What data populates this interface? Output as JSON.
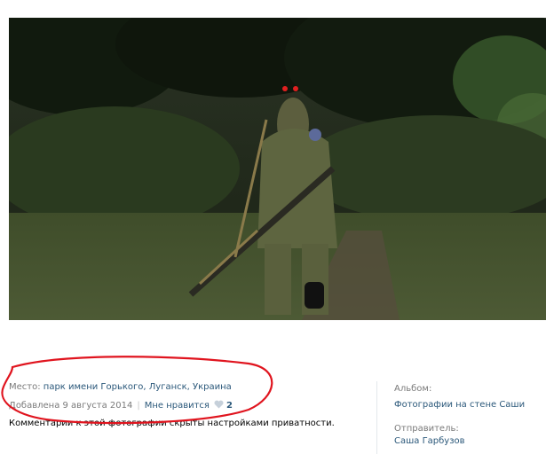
{
  "photo": {
    "icon": "photo-soldier-forest"
  },
  "info": {
    "place_label": "Место:",
    "place_value": "парк имени Горького, Луганск, Украина",
    "added": "Добавлена 9 августа 2014",
    "separator": "|",
    "like_label": "Мне нравится",
    "like_count": "2",
    "comments_note": "Комментарии к этой фотографии скрыты настройками приватности."
  },
  "sidebar": {
    "album_label": "Альбом:",
    "album_value": "Фотографии на стене Саши",
    "sender_label": "Отправитель:",
    "sender_value": "Саша Гарбузов"
  },
  "colors": {
    "link": "#2b587a",
    "muted": "#7a7a7a",
    "annotation": "#e0141e"
  }
}
